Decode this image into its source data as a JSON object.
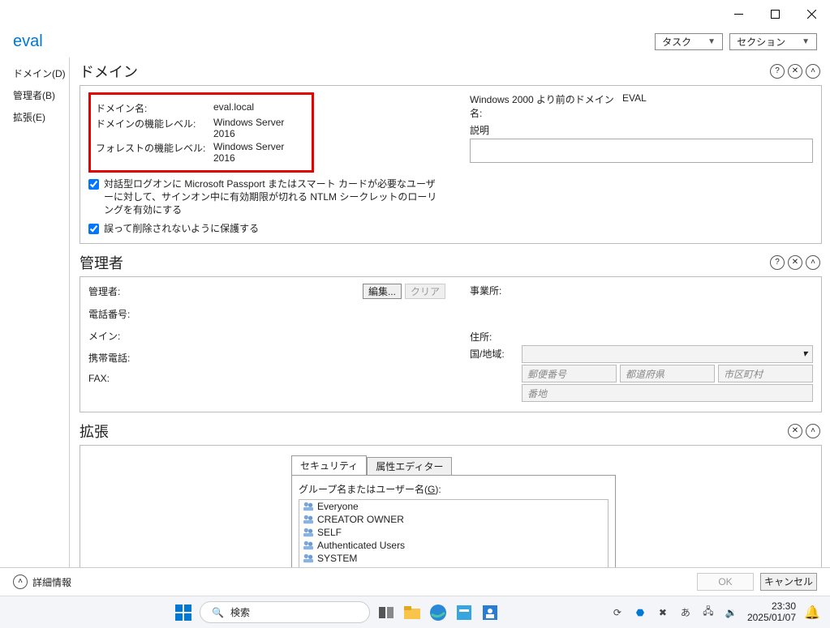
{
  "titlebar": {
    "min": "–",
    "max": "□",
    "close": "✕"
  },
  "toolbar": {
    "app_title": "eval",
    "task_label": "タスク",
    "section_label": "セクション"
  },
  "sidebar": {
    "items": [
      "ドメイン(D)",
      "管理者(B)",
      "拡張(E)"
    ]
  },
  "domain_section": {
    "title": "ドメイン",
    "name_label": "ドメイン名:",
    "name_value": "eval.local",
    "dfl_label": "ドメインの機能レベル:",
    "dfl_value": "Windows Server 2016",
    "ffl_label": "フォレストの機能レベル:",
    "ffl_value": "Windows Server 2016",
    "pre2000_label": "Windows 2000 より前のドメイン名:",
    "pre2000_value": "EVAL",
    "desc_label": "説明",
    "check1_text": "対話型ログオンに Microsoft Passport またはスマート カードが必要なユーザーに対して、サインオン中に有効期限が切れる NTLM シークレットのローリングを有効にする",
    "check2_text": "誤って削除されないように保護する"
  },
  "admin_section": {
    "title": "管理者",
    "admin_label": "管理者:",
    "edit_btn": "編集...",
    "clear_btn": "クリア",
    "phone_label": "電話番号:",
    "main_label": "メイン:",
    "mobile_label": "携帯電話:",
    "fax_label": "FAX:",
    "office_label": "事業所:",
    "address_label": "住所:",
    "country_label": "国/地域:",
    "zip_ph": "郵便番号",
    "pref_ph": "都道府県",
    "city_ph": "市区町村",
    "street_ph": "番地"
  },
  "ext_section": {
    "title": "拡張",
    "tab1": "セキュリティ",
    "tab2": "属性エディター",
    "groups_label_pre": "グループ名またはユーザー名(",
    "groups_hotkey": "G",
    "groups_label_post": "):",
    "groups": [
      "Everyone",
      "CREATOR OWNER",
      "SELF",
      "Authenticated Users",
      "SYSTEM"
    ]
  },
  "footer": {
    "more_info": "詳細情報",
    "ok": "OK",
    "cancel": "キャンセル"
  },
  "taskbar": {
    "search_ph": "検索",
    "time": "23:30",
    "date": "2025/01/07"
  }
}
